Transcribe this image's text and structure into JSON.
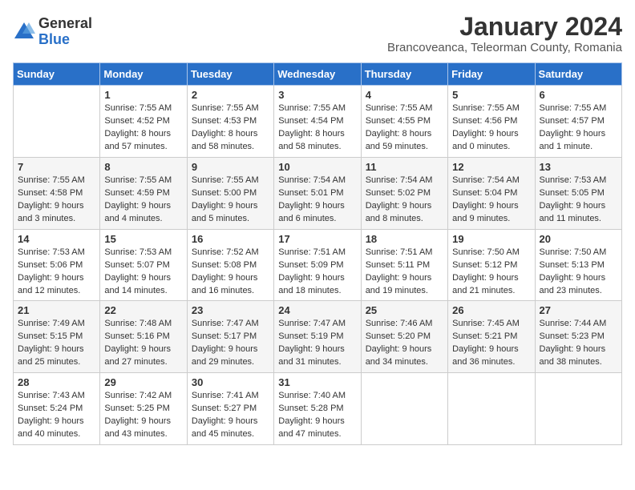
{
  "logo": {
    "general": "General",
    "blue": "Blue"
  },
  "title": "January 2024",
  "subtitle": "Brancoveanca, Teleorman County, Romania",
  "days_of_week": [
    "Sunday",
    "Monday",
    "Tuesday",
    "Wednesday",
    "Thursday",
    "Friday",
    "Saturday"
  ],
  "weeks": [
    [
      {
        "day": "",
        "info": ""
      },
      {
        "day": "1",
        "info": "Sunrise: 7:55 AM\nSunset: 4:52 PM\nDaylight: 8 hours\nand 57 minutes."
      },
      {
        "day": "2",
        "info": "Sunrise: 7:55 AM\nSunset: 4:53 PM\nDaylight: 8 hours\nand 58 minutes."
      },
      {
        "day": "3",
        "info": "Sunrise: 7:55 AM\nSunset: 4:54 PM\nDaylight: 8 hours\nand 58 minutes."
      },
      {
        "day": "4",
        "info": "Sunrise: 7:55 AM\nSunset: 4:55 PM\nDaylight: 8 hours\nand 59 minutes."
      },
      {
        "day": "5",
        "info": "Sunrise: 7:55 AM\nSunset: 4:56 PM\nDaylight: 9 hours\nand 0 minutes."
      },
      {
        "day": "6",
        "info": "Sunrise: 7:55 AM\nSunset: 4:57 PM\nDaylight: 9 hours\nand 1 minute."
      }
    ],
    [
      {
        "day": "7",
        "info": "Sunrise: 7:55 AM\nSunset: 4:58 PM\nDaylight: 9 hours\nand 3 minutes."
      },
      {
        "day": "8",
        "info": "Sunrise: 7:55 AM\nSunset: 4:59 PM\nDaylight: 9 hours\nand 4 minutes."
      },
      {
        "day": "9",
        "info": "Sunrise: 7:55 AM\nSunset: 5:00 PM\nDaylight: 9 hours\nand 5 minutes."
      },
      {
        "day": "10",
        "info": "Sunrise: 7:54 AM\nSunset: 5:01 PM\nDaylight: 9 hours\nand 6 minutes."
      },
      {
        "day": "11",
        "info": "Sunrise: 7:54 AM\nSunset: 5:02 PM\nDaylight: 9 hours\nand 8 minutes."
      },
      {
        "day": "12",
        "info": "Sunrise: 7:54 AM\nSunset: 5:04 PM\nDaylight: 9 hours\nand 9 minutes."
      },
      {
        "day": "13",
        "info": "Sunrise: 7:53 AM\nSunset: 5:05 PM\nDaylight: 9 hours\nand 11 minutes."
      }
    ],
    [
      {
        "day": "14",
        "info": "Sunrise: 7:53 AM\nSunset: 5:06 PM\nDaylight: 9 hours\nand 12 minutes."
      },
      {
        "day": "15",
        "info": "Sunrise: 7:53 AM\nSunset: 5:07 PM\nDaylight: 9 hours\nand 14 minutes."
      },
      {
        "day": "16",
        "info": "Sunrise: 7:52 AM\nSunset: 5:08 PM\nDaylight: 9 hours\nand 16 minutes."
      },
      {
        "day": "17",
        "info": "Sunrise: 7:51 AM\nSunset: 5:09 PM\nDaylight: 9 hours\nand 18 minutes."
      },
      {
        "day": "18",
        "info": "Sunrise: 7:51 AM\nSunset: 5:11 PM\nDaylight: 9 hours\nand 19 minutes."
      },
      {
        "day": "19",
        "info": "Sunrise: 7:50 AM\nSunset: 5:12 PM\nDaylight: 9 hours\nand 21 minutes."
      },
      {
        "day": "20",
        "info": "Sunrise: 7:50 AM\nSunset: 5:13 PM\nDaylight: 9 hours\nand 23 minutes."
      }
    ],
    [
      {
        "day": "21",
        "info": "Sunrise: 7:49 AM\nSunset: 5:15 PM\nDaylight: 9 hours\nand 25 minutes."
      },
      {
        "day": "22",
        "info": "Sunrise: 7:48 AM\nSunset: 5:16 PM\nDaylight: 9 hours\nand 27 minutes."
      },
      {
        "day": "23",
        "info": "Sunrise: 7:47 AM\nSunset: 5:17 PM\nDaylight: 9 hours\nand 29 minutes."
      },
      {
        "day": "24",
        "info": "Sunrise: 7:47 AM\nSunset: 5:19 PM\nDaylight: 9 hours\nand 31 minutes."
      },
      {
        "day": "25",
        "info": "Sunrise: 7:46 AM\nSunset: 5:20 PM\nDaylight: 9 hours\nand 34 minutes."
      },
      {
        "day": "26",
        "info": "Sunrise: 7:45 AM\nSunset: 5:21 PM\nDaylight: 9 hours\nand 36 minutes."
      },
      {
        "day": "27",
        "info": "Sunrise: 7:44 AM\nSunset: 5:23 PM\nDaylight: 9 hours\nand 38 minutes."
      }
    ],
    [
      {
        "day": "28",
        "info": "Sunrise: 7:43 AM\nSunset: 5:24 PM\nDaylight: 9 hours\nand 40 minutes."
      },
      {
        "day": "29",
        "info": "Sunrise: 7:42 AM\nSunset: 5:25 PM\nDaylight: 9 hours\nand 43 minutes."
      },
      {
        "day": "30",
        "info": "Sunrise: 7:41 AM\nSunset: 5:27 PM\nDaylight: 9 hours\nand 45 minutes."
      },
      {
        "day": "31",
        "info": "Sunrise: 7:40 AM\nSunset: 5:28 PM\nDaylight: 9 hours\nand 47 minutes."
      },
      {
        "day": "",
        "info": ""
      },
      {
        "day": "",
        "info": ""
      },
      {
        "day": "",
        "info": ""
      }
    ]
  ]
}
